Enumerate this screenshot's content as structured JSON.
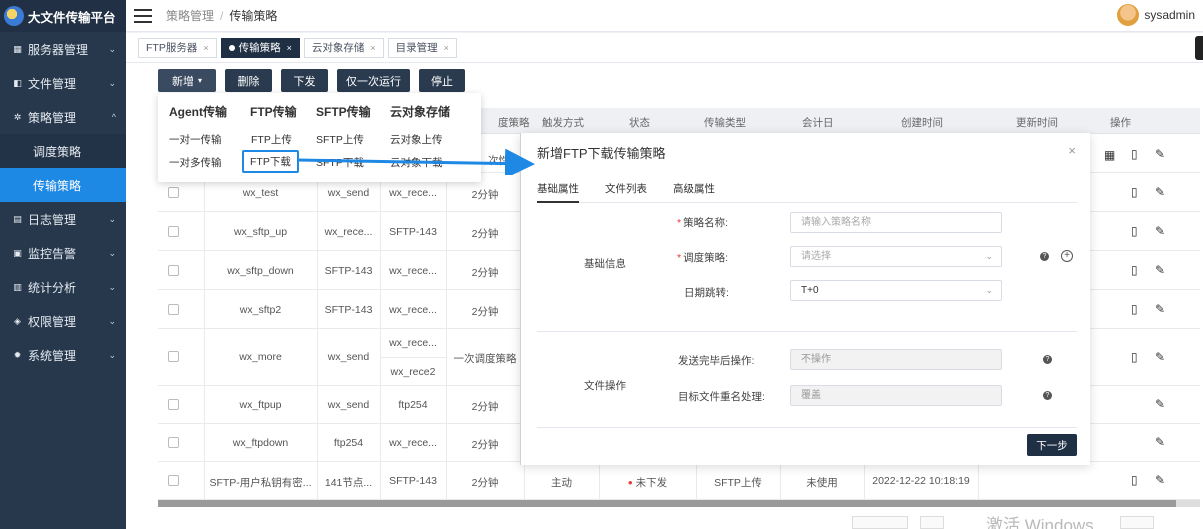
{
  "app": {
    "title": "大文件传输平台"
  },
  "sidebar": {
    "items": [
      {
        "label": "服务器管理",
        "icon": "grid-icon",
        "chevron": "⌄"
      },
      {
        "label": "文件管理",
        "icon": "box-icon",
        "chevron": "⌄"
      },
      {
        "label": "策略管理",
        "icon": "gear-icon",
        "chevron": "^"
      },
      {
        "label": "日志管理",
        "icon": "doc-icon",
        "chevron": "⌄"
      },
      {
        "label": "监控告警",
        "icon": "monitor-icon",
        "chevron": "⌄"
      },
      {
        "label": "统计分析",
        "icon": "chart-icon",
        "chevron": "⌄"
      },
      {
        "label": "权限管理",
        "icon": "shield-icon",
        "chevron": "⌄"
      },
      {
        "label": "系统管理",
        "icon": "settings-icon",
        "chevron": "⌄"
      }
    ],
    "sub_items": [
      {
        "label": "调度策略"
      },
      {
        "label": "传输策略"
      }
    ]
  },
  "header": {
    "breadcrumb": [
      "策略管理",
      "传输策略"
    ],
    "breadcrumb_sep": "/",
    "user": "sysadmin"
  },
  "tabs": [
    {
      "label": "FTP服务器"
    },
    {
      "label": "传输策略"
    },
    {
      "label": "云对象存储"
    },
    {
      "label": "目录管理"
    }
  ],
  "toolbar": {
    "new_label": "新增",
    "delete_label": "删除",
    "issue_label": "下发",
    "run_once_label": "仅一次运行",
    "stop_label": "停止"
  },
  "table": {
    "headers": {
      "schedule": "度策略",
      "trigger": "触发方式",
      "status": "状态",
      "transfer_type": "传输类型",
      "accounting_day": "会计日",
      "created": "创建时间",
      "updated": "更新时间",
      "actions": "操作"
    },
    "first_row_partial": "次性调...",
    "rows": [
      {
        "name": "wx_test",
        "source": "wx_send",
        "target": "wx_rece...",
        "schedule": "2分钟"
      },
      {
        "name": "wx_sftp_up",
        "source": "wx_rece...",
        "target": "SFTP-143",
        "schedule": "2分钟"
      },
      {
        "name": "wx_sftp_down",
        "source": "SFTP-143",
        "target": "wx_rece...",
        "schedule": "2分钟"
      },
      {
        "name": "wx_sftp2",
        "source": "SFTP-143",
        "target": "wx_rece...",
        "schedule": "2分钟"
      },
      {
        "name": "wx_more",
        "source": "wx_send",
        "target": "wx_rece...",
        "target2": "wx_rece2",
        "schedule": "一次调度策略"
      },
      {
        "name": "wx_ftpup",
        "source": "wx_send",
        "target": "ftp254",
        "schedule": "2分钟"
      },
      {
        "name": "wx_ftpdown",
        "source": "ftp254",
        "target": "wx_rece...",
        "schedule": "2分钟"
      },
      {
        "name": "SFTP-用户私钥有密...",
        "source": "141节点...",
        "target": "SFTP-143",
        "schedule": "2分钟",
        "trigger": "主动",
        "status": "未下发",
        "transfer_type": "SFTP上传",
        "accounting_day": "未使用",
        "created": "2022-12-22 10:18:19"
      }
    ]
  },
  "dropdown": {
    "columns": [
      {
        "head": "Agent传输",
        "items": [
          "一对一传输",
          "一对多传输"
        ]
      },
      {
        "head": "FTP传输",
        "items": [
          "FTP上传",
          "FTP下载"
        ]
      },
      {
        "head": "SFTP传输",
        "items": [
          "SFTP上传",
          "SFTP下载"
        ]
      },
      {
        "head": "云对象存储",
        "items": [
          "云对象上传",
          "云对象下载"
        ]
      }
    ]
  },
  "modal": {
    "title": "新增FTP下载传输策略",
    "close": "×",
    "tabs": [
      "基础属性",
      "文件列表",
      "高级属性"
    ],
    "section_basic": "基础信息",
    "policy_name_label": "策略名称:",
    "policy_name_placeholder": "请输入策略名称",
    "schedule_label": "调度策略:",
    "schedule_placeholder": "请选择",
    "date_skip_label": "日期跳转:",
    "date_skip_value": "T+0",
    "section_file": "文件操作",
    "after_send_label": "发送完毕后操作:",
    "after_send_value": "不操作",
    "rename_label": "目标文件重名处理:",
    "rename_value": "覆盖",
    "next_label": "下一步"
  },
  "watermark": "激活 Windows",
  "colors": {
    "accent": "#1e88e5",
    "sidebar_bg": "#27384d",
    "dark_button": "#2a3a4f",
    "required": "#e33333"
  }
}
